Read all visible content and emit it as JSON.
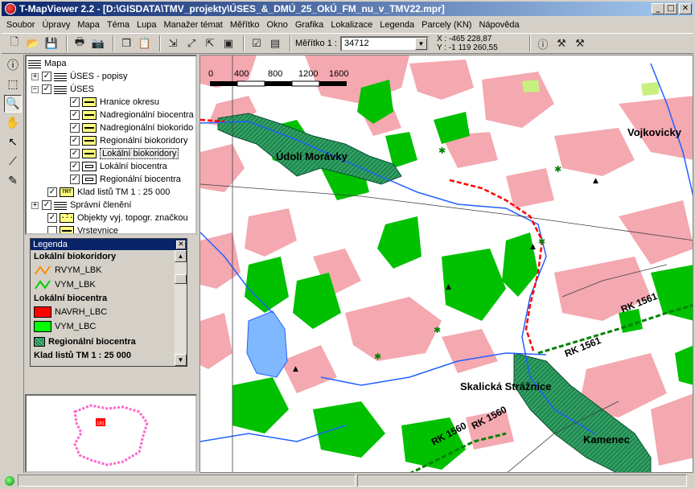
{
  "window": {
    "title": "T-MapViewer 2.2 - [D:\\GISDATA\\TMV_projekty\\ÚSES_&_DMÚ_25_OkÚ_FM_nu_v_TMV22.mpr]",
    "buttons": {
      "minimize": "_",
      "maximize": "□",
      "close": "✕"
    }
  },
  "menu": [
    "Soubor",
    "Úpravy",
    "Mapa",
    "Téma",
    "Lupa",
    "Manažer témat",
    "Měřítko",
    "Okno",
    "Grafika",
    "Lokalizace",
    "Legenda",
    "Parcely (KN)",
    "Nápověda"
  ],
  "toolbar": {
    "scale_label": "Měřítko 1 :",
    "scale_value": "34712",
    "coord_x": "X : -465 228,87",
    "coord_y": "Y : -1 119 260,55",
    "icons": [
      "new-file-icon",
      "open-folder-icon",
      "save-icon",
      "print-icon",
      "camera-icon",
      "copy-icon",
      "paste-icon",
      "overview-icon",
      "zoom-in-icon",
      "zoom-extent-icon",
      "zoom-out-icon",
      "zoom-full-icon",
      "layers-icon",
      "window-icon",
      "info-icon",
      "tools-icon",
      "hammer-icon"
    ]
  },
  "left_tools": [
    "info-icon",
    "select-icon",
    "zoom-icon",
    "pan-icon",
    "info-pointer-icon",
    "measure-icon",
    "pencil-icon"
  ],
  "tree": {
    "root": "Mapa",
    "items": [
      {
        "label": "ÚSES - popisy",
        "expander": "+",
        "checked": true,
        "icon": "layers"
      },
      {
        "label": "ÚSES",
        "expander": "−",
        "checked": true,
        "icon": "layers"
      },
      {
        "label": "Hranice okresu",
        "checked": true,
        "icon": "ylw"
      },
      {
        "label": "Nadregionální biocentra",
        "checked": true,
        "icon": "ylw"
      },
      {
        "label": "Nadregionální biokorido",
        "checked": true,
        "icon": "ylw"
      },
      {
        "label": "Regionální biokoridory",
        "checked": true,
        "icon": "ylw"
      },
      {
        "label": "Lokální biokoridory",
        "checked": true,
        "icon": "ylw",
        "selected": true
      },
      {
        "label": "Lokální biocentra",
        "checked": true,
        "icon": "box"
      },
      {
        "label": "Regionální biocentra",
        "checked": true,
        "icon": "box"
      },
      {
        "label": "Klad listů TM 1 : 25 000",
        "checked": true,
        "icon": "trt",
        "icon_text": "TRT"
      },
      {
        "label": "Správní členění",
        "expander": "+",
        "checked": true,
        "icon": "layers"
      },
      {
        "label": "Objekty vyj. topogr. značkou",
        "checked": true,
        "icon": "dots"
      },
      {
        "label": "Vrstevnice",
        "checked": false,
        "icon": "ylw"
      }
    ]
  },
  "legend": {
    "title": "Legenda",
    "close": "✕",
    "entries": [
      {
        "label": "Lokální biokoridory",
        "bold": true
      },
      {
        "label": "RVYM_LBK",
        "swatch": "line",
        "color": "#ff8c00"
      },
      {
        "label": "VYM_LBK",
        "swatch": "line",
        "color": "#00cc00"
      },
      {
        "label": "Lokální biocentra",
        "bold": true
      },
      {
        "label": "NAVRH_LBC",
        "swatch": "fill",
        "color": "#ff0000"
      },
      {
        "label": "VYM_LBC",
        "swatch": "fill",
        "color": "#00ff00"
      },
      {
        "label": "Regionální biocentra",
        "bold": true,
        "swatch": "hatch",
        "color": "#1e8c50"
      },
      {
        "label": "Klad listů TM 1 : 25 000",
        "bold": true
      }
    ]
  },
  "map": {
    "scalebar_ticks": [
      "0",
      "400",
      "800",
      "1200",
      "1600"
    ],
    "place_labels": [
      "Údolí Morávky",
      "Skalická Strážnice",
      "Kamenec",
      "Vojkovicky"
    ],
    "corridor_labels": [
      "RK 1561",
      "RK 1561",
      "RK 1560",
      "RK 1560"
    ],
    "overview_label": "181",
    "colors": {
      "urban": "#f4a8b0",
      "forest": "#00c000",
      "regional_biocentre": "#1e8c50",
      "water": "#80b8ff",
      "river": "#2060ff",
      "proposal": "#ff0000"
    }
  }
}
